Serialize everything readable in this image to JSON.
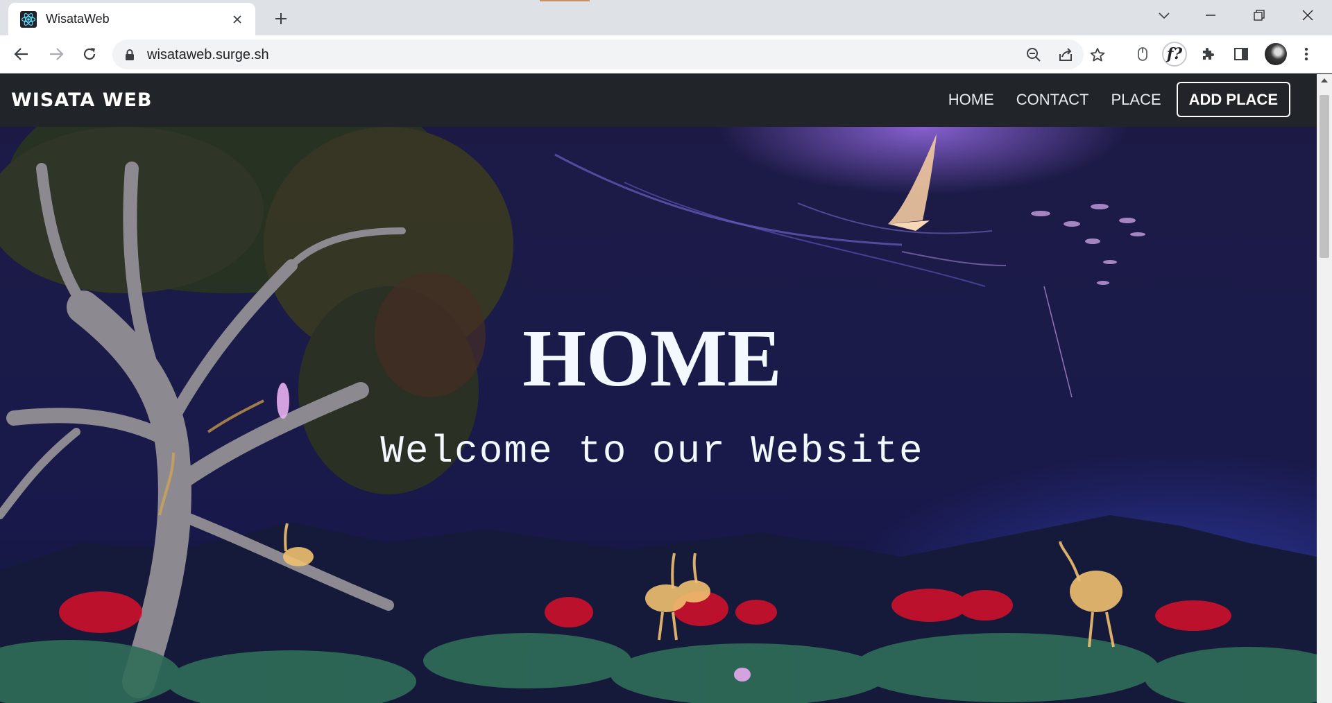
{
  "browser": {
    "tab_title": "WisataWeb",
    "url": "wisataweb.surge.sh"
  },
  "navbar": {
    "brand": "WISATA WEB",
    "links": [
      "HOME",
      "CONTACT",
      "PLACE"
    ],
    "cta": "ADD PLACE"
  },
  "hero": {
    "title": "HOME",
    "subtitle": "Welcome to our Website"
  },
  "icons": {
    "favicon": "react-atom-icon",
    "extension": "f?",
    "accent": "#61dafb"
  }
}
